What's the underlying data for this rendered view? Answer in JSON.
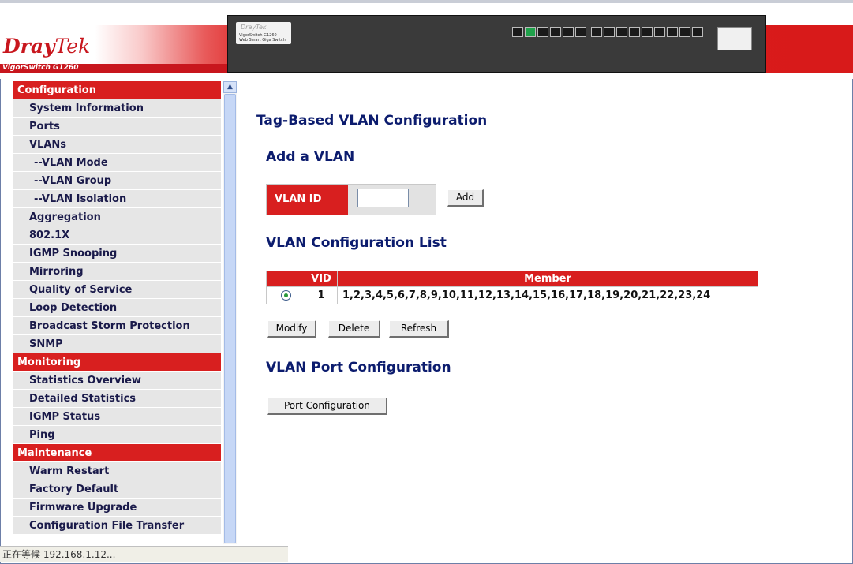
{
  "header": {
    "logo_dray": "Dray",
    "logo_tek": "Tek",
    "model": "VigorSwitch G1260",
    "device_brand": "DrayTek",
    "device_model": "VigorSwitch G1260",
    "device_caption": "Web Smart Giga Switch"
  },
  "sidebar": {
    "sections": [
      {
        "title": "Configuration",
        "items": [
          {
            "label": "System Information"
          },
          {
            "label": "Ports"
          },
          {
            "label": "VLANs"
          },
          {
            "label": "--VLAN Mode",
            "sub": true
          },
          {
            "label": "--VLAN Group",
            "sub": true
          },
          {
            "label": "--VLAN Isolation",
            "sub": true
          },
          {
            "label": "Aggregation"
          },
          {
            "label": "802.1X"
          },
          {
            "label": "IGMP Snooping"
          },
          {
            "label": "Mirroring"
          },
          {
            "label": "Quality of Service"
          },
          {
            "label": "Loop Detection"
          },
          {
            "label": "Broadcast Storm Protection"
          },
          {
            "label": "SNMP"
          }
        ]
      },
      {
        "title": "Monitoring",
        "items": [
          {
            "label": "Statistics Overview"
          },
          {
            "label": "Detailed Statistics"
          },
          {
            "label": "IGMP Status"
          },
          {
            "label": "Ping"
          }
        ]
      },
      {
        "title": "Maintenance",
        "items": [
          {
            "label": "Warm Restart"
          },
          {
            "label": "Factory Default"
          },
          {
            "label": "Firmware Upgrade"
          },
          {
            "label": "Configuration File Transfer"
          }
        ]
      }
    ]
  },
  "main": {
    "title": "Tag-Based VLAN Configuration",
    "add_heading": "Add a VLAN",
    "vlan_id_label": "VLAN ID",
    "vlan_id_value": "",
    "add_button": "Add",
    "list_heading": "VLAN Configuration List",
    "table": {
      "headers": [
        "",
        "VID",
        "Member"
      ],
      "rows": [
        {
          "selected": true,
          "vid": "1",
          "member": "1,2,3,4,5,6,7,8,9,10,11,12,13,14,15,16,17,18,19,20,21,22,23,24"
        }
      ]
    },
    "modify_button": "Modify",
    "delete_button": "Delete",
    "refresh_button": "Refresh",
    "port_heading": "VLAN Port Configuration",
    "port_config_button": "Port Configuration"
  },
  "statusbar": {
    "text": "正在等候 192.168.1.12..."
  },
  "colors": {
    "brand_red": "#d81f1f",
    "heading_blue": "#0c1c6e",
    "menu_bg": "#e6e6e6"
  }
}
